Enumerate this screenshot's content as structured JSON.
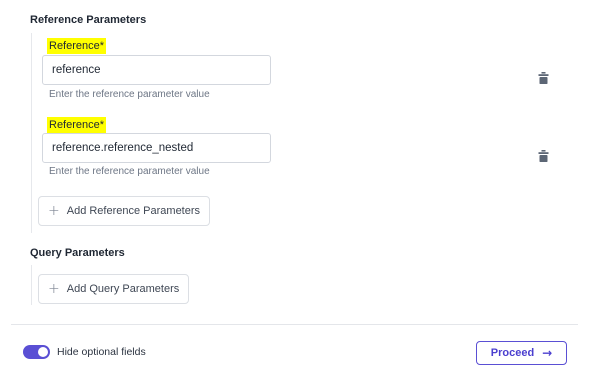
{
  "reference_section": {
    "title": "Reference Parameters",
    "fields": [
      {
        "label": "Reference*",
        "value": "reference",
        "helper": "Enter the reference parameter value"
      },
      {
        "label": "Reference*",
        "value": "reference.reference_nested",
        "helper": "Enter the reference parameter value"
      }
    ],
    "add_label": "Add Reference Parameters"
  },
  "query_section": {
    "title": "Query Parameters",
    "add_label": "Add Query Parameters"
  },
  "footer": {
    "toggle_label": "Hide optional fields",
    "toggle_on": true,
    "proceed_label": "Proceed"
  },
  "icons": {
    "delete": "trash-icon",
    "add": "plus-icon",
    "proceed": "arrow-right-icon"
  },
  "colors": {
    "accent": "#5a4fd4",
    "highlight": "#ffff00"
  }
}
